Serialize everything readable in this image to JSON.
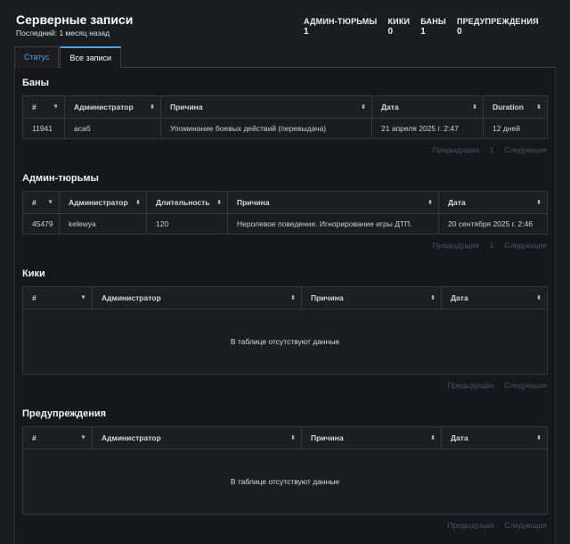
{
  "header": {
    "title": "Серверные записи",
    "subtitle": "Последний: 1 месяц назад"
  },
  "stats": [
    {
      "label": "АДМИН-ТЮРЬМЫ",
      "value": "1"
    },
    {
      "label": "КИКИ",
      "value": "0"
    },
    {
      "label": "БАНЫ",
      "value": "1"
    },
    {
      "label": "ПРЕДУПРЕЖДЕНИЯ",
      "value": "0"
    }
  ],
  "tabs": [
    {
      "label": "Статус"
    },
    {
      "label": "Все записи"
    }
  ],
  "pager": {
    "prev": "Предыдущая",
    "page": "1",
    "next": "Следующая"
  },
  "empty_text": "В таблице отсутствуют данные",
  "bans": {
    "title": "Баны",
    "columns": [
      "#",
      "Администратор",
      "Причина",
      "Дата",
      "Duration"
    ],
    "rows": [
      [
        "11941",
        "асаб",
        "Упоминание боевых действий (перевыдача)",
        "21 апреля 2025 г. 2:47",
        "12 дней"
      ]
    ]
  },
  "jails": {
    "title": "Админ-тюрьмы",
    "columns": [
      "#",
      "Администратор",
      "Длительность",
      "Причина",
      "Дата"
    ],
    "rows": [
      [
        "45479",
        "kelewya",
        "120",
        "Неролевое поведение. Игнорирование игры ДТП.",
        "20 сентября 2025 г. 2:46"
      ]
    ]
  },
  "kicks": {
    "title": "Кики",
    "columns": [
      "#",
      "Администратор",
      "Причина",
      "Дата"
    ]
  },
  "warnings": {
    "title": "Предупреждения",
    "columns": [
      "#",
      "Администратор",
      "Причина",
      "Дата"
    ]
  }
}
